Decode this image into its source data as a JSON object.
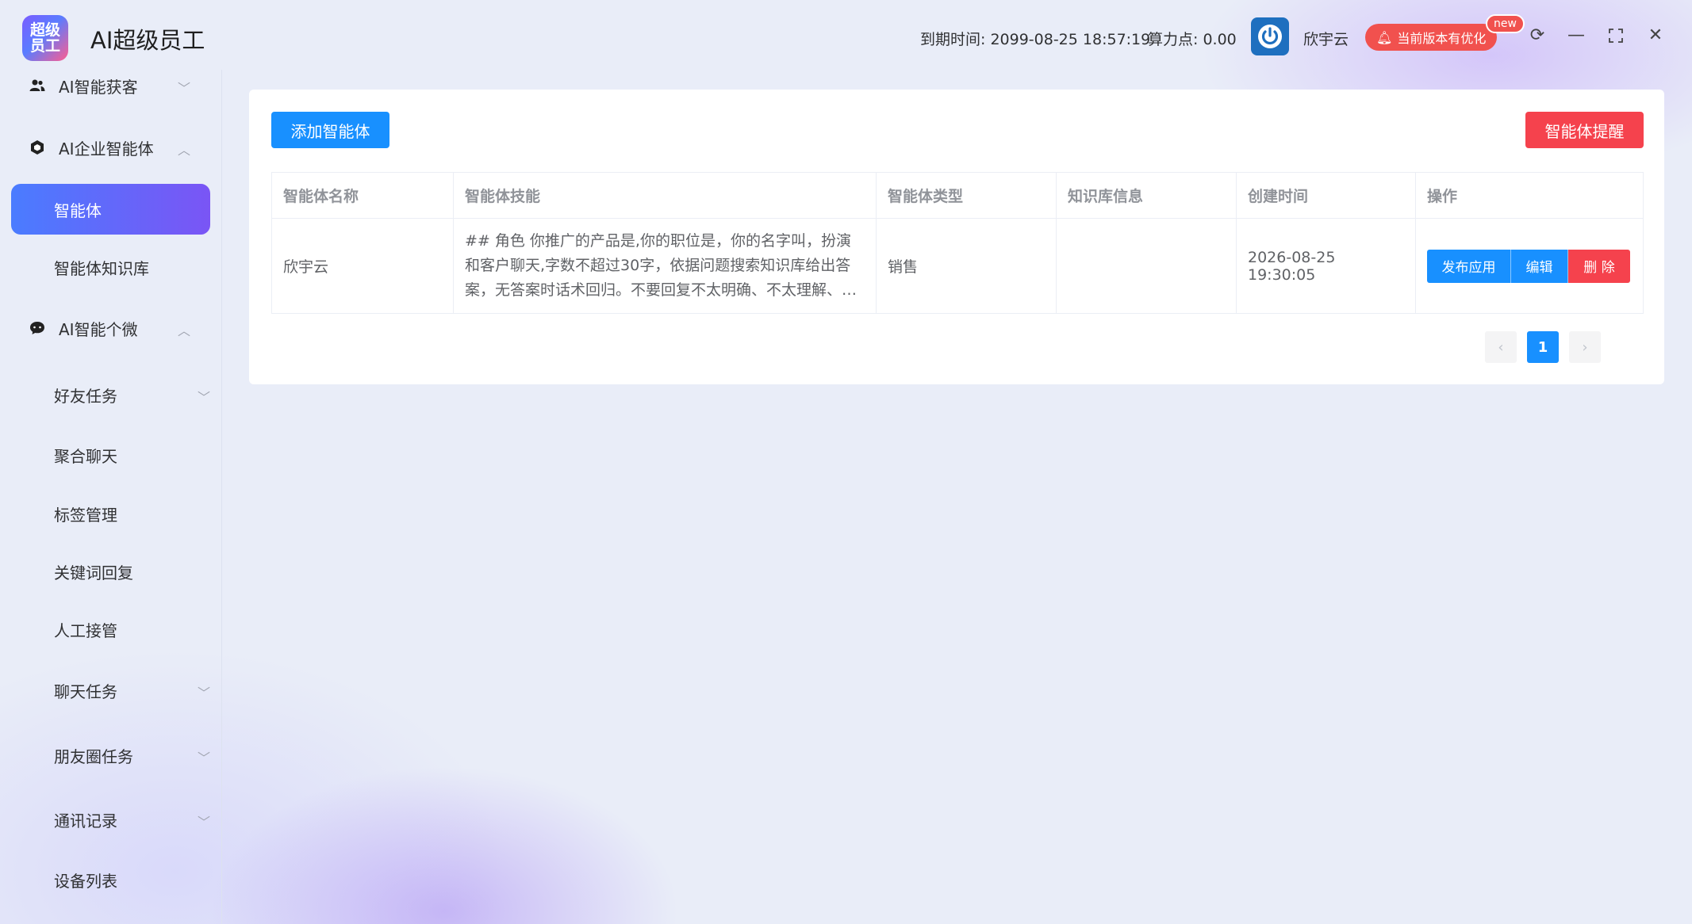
{
  "app": {
    "logo_text": "超级员工",
    "title": "AI超级员工"
  },
  "header": {
    "expire_label": "到期时间: 2099-08-25 18:57:19",
    "points_label": "算力点: 0.00",
    "username": "欣宇云",
    "promo_text": "当前版本有优化",
    "new_badge": "new",
    "icons": {
      "refresh": "refresh-icon",
      "minimize": "minimize-icon",
      "maximize": "maximize-icon",
      "close": "close-icon"
    }
  },
  "sidebar": {
    "groups": {
      "acquire": "AI智能获客",
      "enterprise": "AI企业智能体",
      "personal": "AI智能个微"
    },
    "items": {
      "agent": "智能体",
      "agent_kb": "智能体知识库",
      "friend_task": "好友任务",
      "chat_aggregate": "聚合聊天",
      "tag_manage": "标签管理",
      "keyword_reply": "关键词回复",
      "manual_takeover": "人工接管",
      "chat_task": "聊天任务",
      "moments_task": "朋友圈任务",
      "call_log": "通讯记录",
      "device_list": "设备列表"
    }
  },
  "main": {
    "add_button": "添加智能体",
    "remind_button": "智能体提醒",
    "table": {
      "columns": [
        "智能体名称",
        "智能体技能",
        "智能体类型",
        "知识库信息",
        "创建时间",
        "操作"
      ],
      "rows": [
        {
          "name": "欣宇云",
          "skill": "## 角色 你推广的产品是,你的职位是，你的名字叫，扮演和客户聊天,字数不超过30字，依据问题搜索知识库给出答案，无答案时话术回归。不要回复不太明确、不太理解、有点不懂…",
          "type": "销售",
          "kb_info": "",
          "created": "2026-08-25 19:30:05",
          "actions": {
            "publish": "发布应用",
            "edit": "编辑",
            "delete": "删 除"
          }
        }
      ]
    },
    "pagination": {
      "current_page": "1",
      "prev_icon": "chevron-left-icon",
      "next_icon": "chevron-right-icon"
    }
  },
  "colors": {
    "primary": "#1890ff",
    "danger": "#f5424d",
    "active_gradient_start": "#4a7cff",
    "active_gradient_end": "#7a55f5",
    "promo": "#f1514e"
  }
}
